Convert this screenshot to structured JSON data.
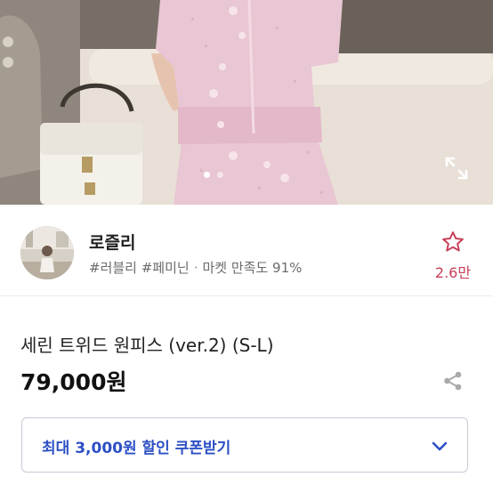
{
  "hero": {
    "icons": {
      "expand": "expand-arrows-icon"
    },
    "pager": {
      "count": 2,
      "active": 0
    }
  },
  "seller": {
    "name": "로즐리",
    "tags": "#러블리 #페미닌",
    "separator": "·",
    "satisfaction": "마켓 만족도 91%",
    "favorite_count": "2.6만",
    "icons": {
      "favorite": "star-outline-icon"
    }
  },
  "product": {
    "title": "세린 트위드 원피스 (ver.2) (S-L)",
    "price": "79,000원",
    "icons": {
      "share": "share-icon"
    }
  },
  "coupon": {
    "label": "최대 3,000원 할인 쿠폰받기",
    "icons": {
      "toggle": "chevron-down-icon"
    }
  },
  "colors": {
    "accent_blue": "#2c4fc4",
    "favorite_pink": "#c8405a",
    "coupon_border": "#c7cbd6"
  }
}
